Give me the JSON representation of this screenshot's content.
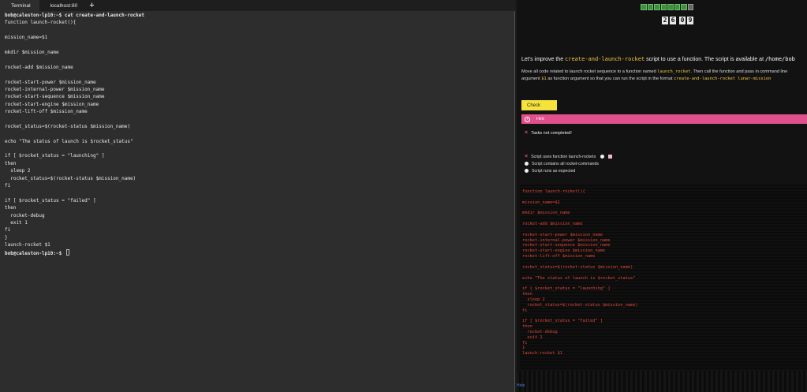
{
  "tabs": [
    {
      "label": "Terminal",
      "active": true
    },
    {
      "label": "localhost:80",
      "active": false
    }
  ],
  "new_tab_symbol": "+",
  "terminal_lines": [
    {
      "text": "bob@caleston-lp10:~$ cat create-and-launch-rocket",
      "bold": true
    },
    {
      "text": "function launch-rocket(){",
      "bold": false
    },
    {
      "text": "",
      "bold": false
    },
    {
      "text": "mission_name=$1",
      "bold": false
    },
    {
      "text": "",
      "bold": false
    },
    {
      "text": "mkdir $mission_name",
      "bold": false
    },
    {
      "text": "",
      "bold": false
    },
    {
      "text": "rocket-add $mission_name",
      "bold": false
    },
    {
      "text": "",
      "bold": false
    },
    {
      "text": "rocket-start-power $mission_name",
      "bold": false
    },
    {
      "text": "rocket-internal-power $mission_name",
      "bold": false
    },
    {
      "text": "rocket-start-sequence $mission_name",
      "bold": false
    },
    {
      "text": "rocket-start-engine $mission_name",
      "bold": false
    },
    {
      "text": "rocket-lift-off $mission_name",
      "bold": false
    },
    {
      "text": "",
      "bold": false
    },
    {
      "text": "rocket_status=$(rocket-status $mission_name)",
      "bold": false
    },
    {
      "text": "",
      "bold": false
    },
    {
      "text": "echo \"The status of launch is $rocket_status\"",
      "bold": false
    },
    {
      "text": "",
      "bold": false
    },
    {
      "text": "if [ $rocket_status = \"launching\" ]",
      "bold": false
    },
    {
      "text": "then",
      "bold": false
    },
    {
      "text": "  sleep 2",
      "bold": false
    },
    {
      "text": "  rocket_status=$(rocket-status $mission_name)",
      "bold": false
    },
    {
      "text": "fi",
      "bold": false
    },
    {
      "text": "",
      "bold": false
    },
    {
      "text": "if [ $rocket_status = \"failed\" ]",
      "bold": false
    },
    {
      "text": "then",
      "bold": false
    },
    {
      "text": "  rocket-debug",
      "bold": false
    },
    {
      "text": "  exit 1",
      "bold": false
    },
    {
      "text": "fi",
      "bold": false
    },
    {
      "text": "}",
      "bold": false
    },
    {
      "text": "launch-rocket $1",
      "bold": false
    },
    {
      "text": "bob@caleston-lp10:~$ ",
      "bold": true,
      "cursor": true
    }
  ],
  "progress_squares": [
    "done",
    "done",
    "done",
    "done",
    "done",
    "done",
    "done",
    "current"
  ],
  "timer_digits": [
    "2",
    "6",
    "0",
    "9"
  ],
  "task": {
    "intro_prefix": "Let's improve the ",
    "intro_script": "create-and-launch-rocket",
    "intro_mid": " script to use a function. The script is available at ",
    "intro_path": "/home/bob",
    "desc_part1": "Move all code related to launch rocket sequence to a function named ",
    "desc_func": "launch_rocket",
    "desc_part2": ". Then call the function and pass in command line argument ",
    "desc_arg": "$1",
    "desc_part3": " as function argument so that you can run the script in the format ",
    "desc_format": "create-and-launch-rocket lunar-mission"
  },
  "check_label": "Check",
  "hint_label": "Hint",
  "status_text": "Tasks not completed!",
  "checks": [
    {
      "label": "Script uses function launch-rockets",
      "state": "fail"
    },
    {
      "label": "Script contains all rocket-commands",
      "state": "pending"
    },
    {
      "label": "Script runs as expected",
      "state": "pending"
    }
  ],
  "code_lines": [
    "function launch-rocket(){",
    "",
    "mission_name=$1",
    "",
    "mkdir $mission_name",
    "",
    "rocket-add $mission_name",
    "",
    "rocket-start-power $mission_name",
    "rocket-internal-power $mission_name",
    "rocket-start-sequence $mission_name",
    "rocket-start-engine $mission_name",
    "rocket-lift-off $mission_name",
    "",
    "rocket_status=$(rocket-status $mission_name)",
    "",
    "echo \"The status of launch is $rocket_status\"",
    "",
    "if [ $rocket_status = \"launching\" ]",
    "then",
    "  sleep 2",
    "  rocket_status=$(rocket-status $mission_name)",
    "fi",
    "",
    "if [ $rocket_status = \"failed\" ]",
    "then",
    "  rocket-debug",
    "  exit 1",
    "fi",
    "}",
    "launch-rocket $1"
  ],
  "bottom_label": "Help",
  "colors": {
    "accent_yellow": "#f5e33b",
    "hint_pink": "#e0508a",
    "code_red": "#e04a3a",
    "progress_green": "#3f8f3f"
  }
}
